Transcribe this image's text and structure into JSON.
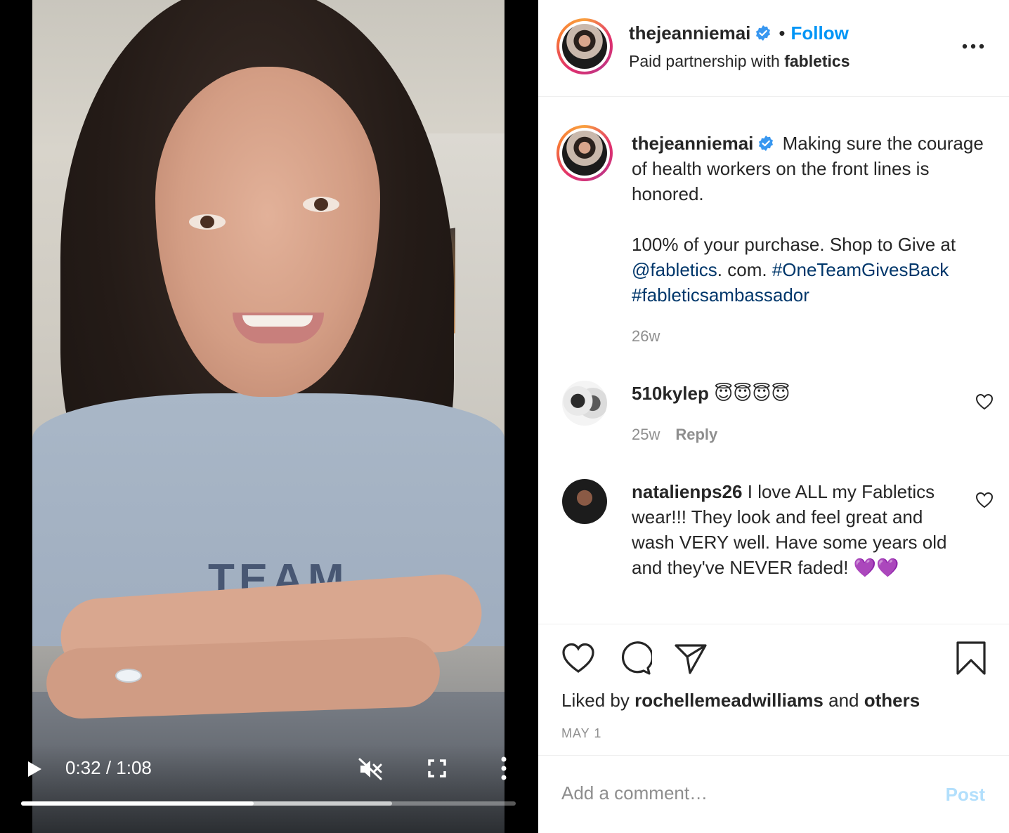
{
  "video": {
    "time_current": "0:32",
    "time_total": "1:08",
    "time_display": "0:32 / 1:08",
    "progress_fraction": 0.47,
    "buffered_fraction": 0.75,
    "muted": true,
    "shirt_text": "TEAM"
  },
  "header": {
    "username": "thejeanniemai",
    "verified": true,
    "follow_label": "Follow",
    "separator": "•",
    "partnership_prefix": "Paid partnership with",
    "partner": "fabletics"
  },
  "caption": {
    "username": "thejeanniemai",
    "line1": "Making sure the courage of health workers on the front lines is honored.",
    "line2_text": "100% of your purchase. Shop to Give at",
    "mention": "@fabletics",
    "after_mention": ". com.",
    "hashtag1": "#OneTeamGivesBack",
    "hashtag2": "#fableticsambassador",
    "age": "26w"
  },
  "comments": [
    {
      "username": "510kylep",
      "text": "😇😇😇😇",
      "age": "25w",
      "reply_label": "Reply"
    },
    {
      "username": "natalienps26",
      "text": "I love ALL my Fabletics wear!!! They look and feel great and wash VERY well. Have some years old and they've NEVER faded! 💜💜"
    }
  ],
  "actions": {
    "liked_by_prefix": "Liked by",
    "liked_by_user": "rochellemeadwilliams",
    "liked_and": "and",
    "liked_others": "others",
    "date": "MAY 1"
  },
  "composer": {
    "placeholder": "Add a comment…",
    "post_label": "Post"
  },
  "colors": {
    "accent": "#0095f6",
    "link": "#00376b",
    "muted_text": "#8e8e8e",
    "post_disabled": "#b2dffc"
  }
}
